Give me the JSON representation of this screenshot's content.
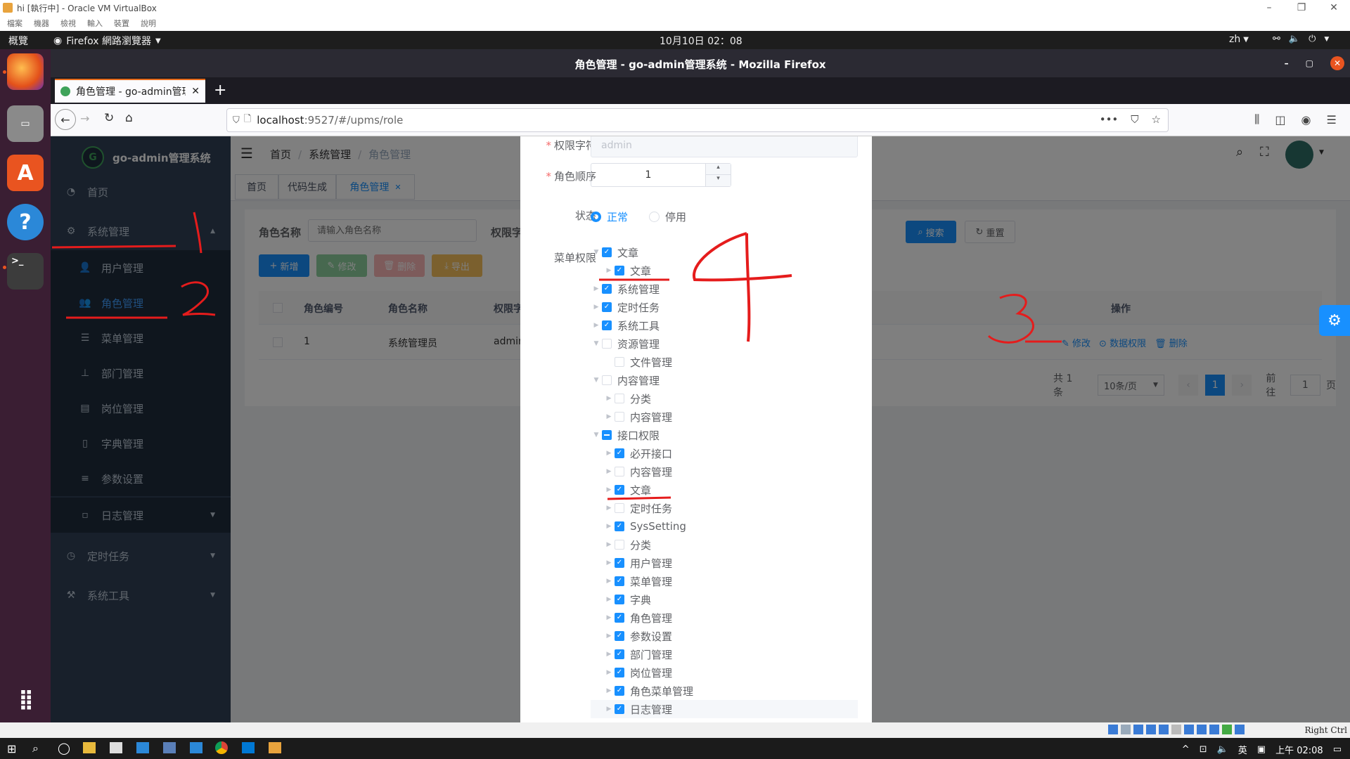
{
  "vbox": {
    "title": "hi [執行中] - Oracle VM VirtualBox",
    "menu": [
      "檔案",
      "機器",
      "檢視",
      "輸入",
      "裝置",
      "說明"
    ],
    "host_key": "Right Ctrl"
  },
  "ubuntu": {
    "activities": "概覽",
    "app_menu": "Firefox 網路瀏覽器",
    "clock": "10月10日 02：08",
    "lang": "zh"
  },
  "firefox": {
    "window_title": "角色管理 - go-admin管理系统 - Mozilla Firefox",
    "tab_title": "角色管理 - go-admin管理",
    "url_host": "localhost",
    "url_rest": ":9527/#/upms/role"
  },
  "sidebar": {
    "brand": "go-admin管理系统",
    "items": [
      {
        "label": "首页",
        "icon": "dashboard-icon"
      },
      {
        "label": "系统管理",
        "icon": "gear-icon"
      },
      {
        "label": "用户管理",
        "icon": "user-icon"
      },
      {
        "label": "角色管理",
        "icon": "peoples-icon"
      },
      {
        "label": "菜单管理",
        "icon": "menu-list-icon"
      },
      {
        "label": "部门管理",
        "icon": "tree-icon"
      },
      {
        "label": "岗位管理",
        "icon": "post-icon"
      },
      {
        "label": "字典管理",
        "icon": "book-icon"
      },
      {
        "label": "参数设置",
        "icon": "list-icon"
      },
      {
        "label": "日志管理",
        "icon": "log-icon"
      },
      {
        "label": "定时任务",
        "icon": "clock-icon"
      },
      {
        "label": "系统工具",
        "icon": "tool-icon"
      }
    ]
  },
  "breadcrumb": [
    "首页",
    "系统管理",
    "角色管理"
  ],
  "tags": [
    "首页",
    "代码生成",
    "角色管理"
  ],
  "search": {
    "role_name_label": "角色名称",
    "role_name_placeholder": "请输入角色名称",
    "role_key_label": "权限字符",
    "search_btn": "搜索",
    "reset_btn": "重置"
  },
  "toolbar": {
    "add": "新增",
    "edit": "修改",
    "delete": "删除",
    "export": "导出"
  },
  "table": {
    "headers": [
      "角色编号",
      "角色名称",
      "权限字符",
      "操作"
    ],
    "rows": [
      {
        "id": "1",
        "name": "系统管理员",
        "key": "admin"
      }
    ],
    "actions": {
      "edit": "修改",
      "data_scope": "数据权限",
      "delete": "删除"
    }
  },
  "pagination": {
    "total": "共 1 条",
    "page_size": "10条/页",
    "current": "1",
    "goto_label": "前往",
    "goto_value": "1",
    "page_suffix": "页"
  },
  "dialog": {
    "role_key_label": "权限字符",
    "role_key_value": "admin",
    "sort_label": "角色顺序",
    "sort_value": "1",
    "status_label": "状态",
    "status_normal": "正常",
    "status_disabled": "停用",
    "menu_label": "菜单权限",
    "tree": [
      {
        "label": "文章",
        "level": 0,
        "state": "checked",
        "arrow": "down"
      },
      {
        "label": "文章",
        "level": 1,
        "state": "checked",
        "arrow": "right"
      },
      {
        "label": "系统管理",
        "level": 0,
        "state": "checked",
        "arrow": "right"
      },
      {
        "label": "定时任务",
        "level": 0,
        "state": "checked",
        "arrow": "right"
      },
      {
        "label": "系统工具",
        "level": 0,
        "state": "checked",
        "arrow": "right"
      },
      {
        "label": "资源管理",
        "level": 0,
        "state": "unchecked",
        "arrow": "down"
      },
      {
        "label": "文件管理",
        "level": 1,
        "state": "unchecked",
        "arrow": "none"
      },
      {
        "label": "内容管理",
        "level": 0,
        "state": "unchecked",
        "arrow": "down"
      },
      {
        "label": "分类",
        "level": 1,
        "state": "unchecked",
        "arrow": "right"
      },
      {
        "label": "内容管理",
        "level": 1,
        "state": "unchecked",
        "arrow": "right"
      },
      {
        "label": "接口权限",
        "level": 0,
        "state": "half",
        "arrow": "down"
      },
      {
        "label": "必开接口",
        "level": 1,
        "state": "checked",
        "arrow": "right"
      },
      {
        "label": "内容管理",
        "level": 1,
        "state": "unchecked",
        "arrow": "right"
      },
      {
        "label": "文章",
        "level": 1,
        "state": "checked",
        "arrow": "right"
      },
      {
        "label": "定时任务",
        "level": 1,
        "state": "unchecked",
        "arrow": "right"
      },
      {
        "label": "SysSetting",
        "level": 1,
        "state": "checked",
        "arrow": "right"
      },
      {
        "label": "分类",
        "level": 1,
        "state": "unchecked",
        "arrow": "right"
      },
      {
        "label": "用户管理",
        "level": 1,
        "state": "checked",
        "arrow": "right"
      },
      {
        "label": "菜单管理",
        "level": 1,
        "state": "checked",
        "arrow": "right"
      },
      {
        "label": "字典",
        "level": 1,
        "state": "checked",
        "arrow": "right"
      },
      {
        "label": "角色管理",
        "level": 1,
        "state": "checked",
        "arrow": "right"
      },
      {
        "label": "参数设置",
        "level": 1,
        "state": "checked",
        "arrow": "right"
      },
      {
        "label": "部门管理",
        "level": 1,
        "state": "checked",
        "arrow": "right"
      },
      {
        "label": "岗位管理",
        "level": 1,
        "state": "checked",
        "arrow": "right"
      },
      {
        "label": "角色菜单管理",
        "level": 1,
        "state": "checked",
        "arrow": "right"
      },
      {
        "label": "日志管理",
        "level": 1,
        "state": "checked",
        "arrow": "right"
      }
    ]
  },
  "taskbar": {
    "clock": "上午 02:08",
    "ime": "英"
  },
  "colors": {
    "primary": "#1890ff",
    "sidebar_bg": "#304156",
    "annotation": "#e51c1c"
  }
}
